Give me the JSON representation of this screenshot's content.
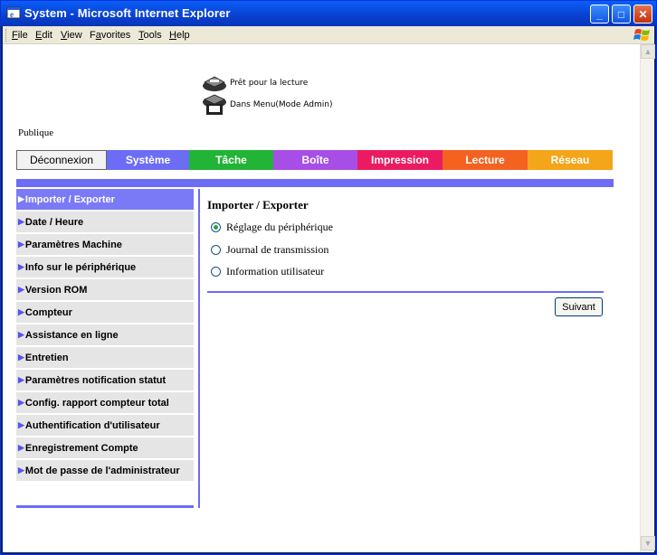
{
  "window": {
    "title": "System - Microsoft Internet Explorer",
    "controls": {
      "minimize": "_",
      "maximize": "□",
      "close": "✕"
    }
  },
  "menubar": {
    "items": [
      {
        "label_acc": "F",
        "label_rest": "ile"
      },
      {
        "label_acc": "E",
        "label_rest": "dit"
      },
      {
        "label_acc": "V",
        "label_rest": "iew"
      },
      {
        "label_pre": "F",
        "label_acc": "a",
        "label_rest": "vorites"
      },
      {
        "label_acc": "T",
        "label_rest": "ools"
      },
      {
        "label_acc": "H",
        "label_rest": "elp"
      }
    ]
  },
  "status": {
    "ready": "Prêt pour la lecture",
    "menu": "Dans Menu(Mode Admin)"
  },
  "mode_label": "Publique",
  "tabs": {
    "logout": "Déconnexion",
    "items": [
      {
        "label": "Système",
        "color": "#6c6cf5"
      },
      {
        "label": "Tâche",
        "color": "#22b436"
      },
      {
        "label": "Boîte",
        "color": "#a64ee6"
      },
      {
        "label": "Impression",
        "color": "#ea1b62"
      },
      {
        "label": "Lecture",
        "color": "#f46221"
      },
      {
        "label": "Réseau",
        "color": "#f5a519"
      }
    ]
  },
  "sidebar": {
    "items": [
      {
        "label": "Importer / Exporter",
        "active": true
      },
      {
        "label": "Date / Heure"
      },
      {
        "label": "Paramètres Machine"
      },
      {
        "label": "Info sur le périphérique"
      },
      {
        "label": "Version ROM"
      },
      {
        "label": "Compteur"
      },
      {
        "label": "Assistance en ligne"
      },
      {
        "label": "Entretien"
      },
      {
        "label": "Paramètres notification statut"
      },
      {
        "label": "Config. rapport compteur total"
      },
      {
        "label": "Authentification d'utilisateur"
      },
      {
        "label": "Enregistrement Compte"
      },
      {
        "label": "Mot de passe de l'administrateur"
      }
    ]
  },
  "main": {
    "title": "Importer / Exporter",
    "options": [
      {
        "label": "Réglage du périphérique",
        "checked": true
      },
      {
        "label": "Journal de transmission",
        "checked": false
      },
      {
        "label": "Information utilisateur",
        "checked": false
      }
    ],
    "next_button": "Suivant"
  }
}
